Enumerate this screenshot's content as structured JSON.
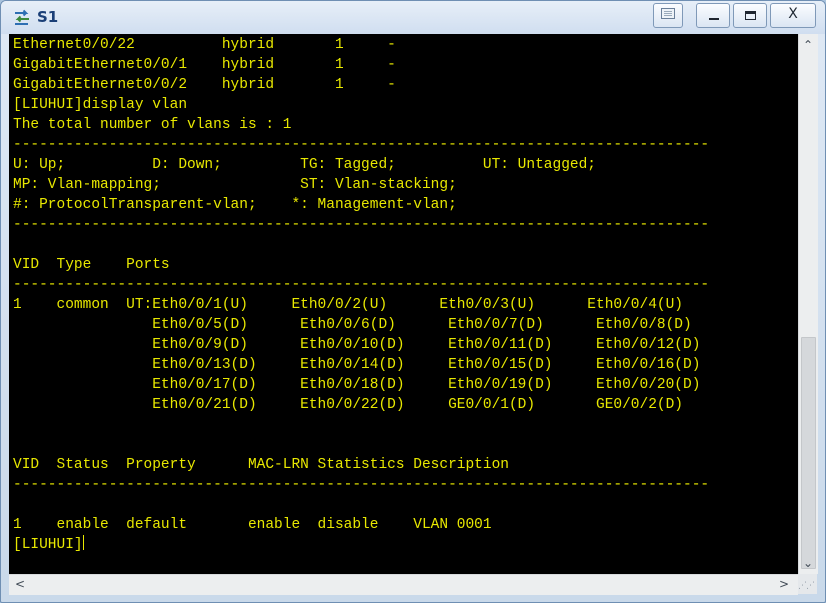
{
  "window": {
    "title": "S1",
    "icon": "switch-icon"
  },
  "terminal": {
    "lines": [
      "Ethernet0/0/22          hybrid       1     -",
      "GigabitEthernet0/0/1    hybrid       1     -",
      "GigabitEthernet0/0/2    hybrid       1     -",
      "[LIUHUI]display vlan",
      "The total number of vlans is : 1",
      "--------------------------------------------------------------------------------",
      "U: Up;          D: Down;         TG: Tagged;          UT: Untagged;",
      "MP: Vlan-mapping;                ST: Vlan-stacking;",
      "#: ProtocolTransparent-vlan;    *: Management-vlan;",
      "--------------------------------------------------------------------------------",
      "",
      "VID  Type    Ports",
      "--------------------------------------------------------------------------------",
      "1    common  UT:Eth0/0/1(U)     Eth0/0/2(U)      Eth0/0/3(U)      Eth0/0/4(U)",
      "                Eth0/0/5(D)      Eth0/0/6(D)      Eth0/0/7(D)      Eth0/0/8(D)",
      "                Eth0/0/9(D)      Eth0/0/10(D)     Eth0/0/11(D)     Eth0/0/12(D)",
      "                Eth0/0/13(D)     Eth0/0/14(D)     Eth0/0/15(D)     Eth0/0/16(D)",
      "                Eth0/0/17(D)     Eth0/0/18(D)     Eth0/0/19(D)     Eth0/0/20(D)",
      "                Eth0/0/21(D)     Eth0/0/22(D)     GE0/0/1(D)       GE0/0/2(D)",
      "",
      "",
      "VID  Status  Property      MAC-LRN Statistics Description",
      "--------------------------------------------------------------------------------",
      "",
      "1    enable  default       enable  disable    VLAN 0001",
      "[LIUHUI]"
    ]
  }
}
